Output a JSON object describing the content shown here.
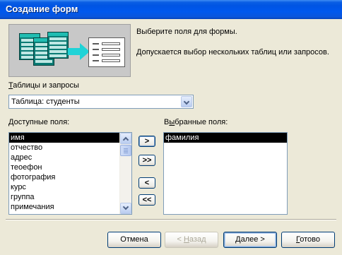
{
  "window": {
    "title": "Создание форм"
  },
  "header": {
    "instruction": "Выберите поля для формы.",
    "hint": "Допускается выбор нескольких таблиц или запросов."
  },
  "source": {
    "label_pre": "",
    "label_key": "Т",
    "label_rest": "аблицы и запросы",
    "selected": "Таблица: студенты"
  },
  "available": {
    "label_key": "Д",
    "label_rest": "оступные поля:",
    "items": [
      "имя",
      "отчество",
      "адрес",
      "теоефон",
      "фотография",
      "курс",
      "группа",
      "примечания"
    ],
    "selected_index": 0
  },
  "selected_fields": {
    "label_pre": "В",
    "label_key": "ы",
    "label_rest": "бранные поля:",
    "items": [
      "фамилия"
    ]
  },
  "move_buttons": {
    "add_one": ">",
    "add_all": ">>",
    "remove_one": "<",
    "remove_all": "<<"
  },
  "footer": {
    "cancel": "Отмена",
    "back_pre": "< ",
    "back_key": "Н",
    "back_rest": "азад",
    "next_key": "Д",
    "next_rest": "алее >",
    "finish_key": "Г",
    "finish_rest": "отово"
  },
  "colors": {
    "title_bar": "#0054E3",
    "selection": "#000000",
    "dialog_bg": "#ECE9D8"
  },
  "icons": [
    "form-wizard-illustration-icon",
    "chevron-down-icon",
    "scroll-up-icon",
    "scroll-down-icon"
  ]
}
